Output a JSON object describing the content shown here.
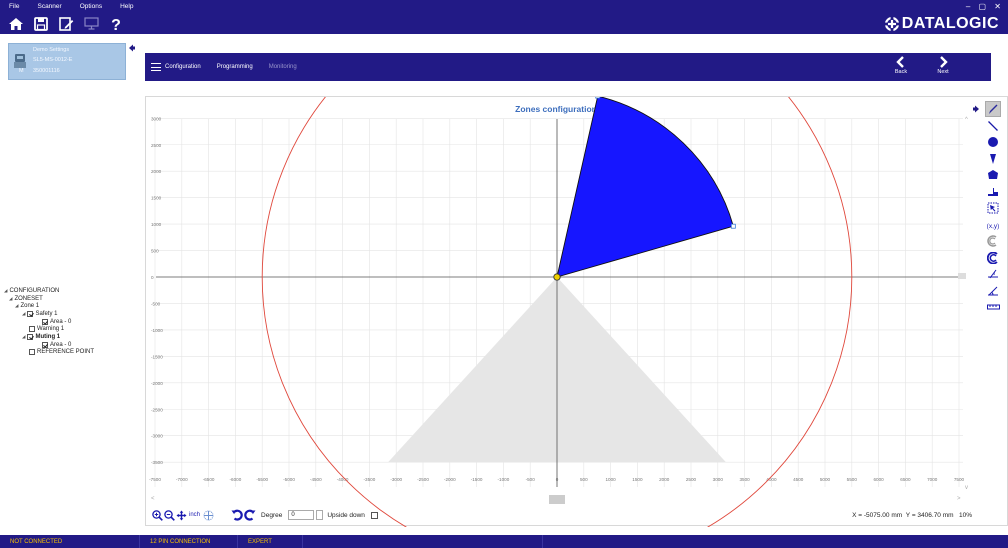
{
  "menu": {
    "items": [
      "File",
      "Scanner",
      "Options",
      "Help"
    ],
    "window_controls": "– ▢ ✕"
  },
  "brand": {
    "name": "DATALOGIC"
  },
  "device": {
    "title": "Demo Settings",
    "model": "SL5-MS-0012-E",
    "serial_prefix": "M",
    "serial": "350001116"
  },
  "nav": {
    "tabs": [
      "Configuration",
      "Programming",
      "Monitoring"
    ],
    "back_label": "Back",
    "next_label": "Next"
  },
  "tree": {
    "configuration": "CONFIGURATION",
    "zoneset": "ZONESET",
    "zone1": "Zone 1",
    "safety1": "Safety 1",
    "safety_area": "Area - 0",
    "warning1": "Warning 1",
    "muting1": "Muting 1",
    "muting_area": "Area - 0",
    "reference_point": "REFERENCE POINT"
  },
  "chart_data": {
    "type": "polar-zone-editor",
    "title": "Zones configuration",
    "xlim": [
      -7500,
      7500
    ],
    "ylim": [
      -3500,
      3500
    ],
    "xticks": [
      -7500,
      -7000,
      -6500,
      -6000,
      -5500,
      -5000,
      -4500,
      -4000,
      -3500,
      -3000,
      -2500,
      -2000,
      -1500,
      -1000,
      -500,
      0,
      500,
      1000,
      1500,
      2000,
      2500,
      3000,
      3500,
      4000,
      4500,
      5000,
      5500,
      6000,
      6500,
      7000,
      7500
    ],
    "yticks": [
      3500,
      3000,
      2500,
      2000,
      1500,
      1000,
      500,
      0,
      -500,
      -1000,
      -1500,
      -2000,
      -2500,
      -3000,
      -3500
    ],
    "grid": true,
    "range_circle_radius": 5500,
    "safety_zone": {
      "color": "#1616ff",
      "vertices": [
        [
          0,
          0
        ],
        [
          760,
          3420
        ],
        [
          3290,
          960
        ]
      ]
    },
    "blind_area": {
      "apex": [
        0,
        0
      ],
      "left": [
        -3150,
        -3500
      ],
      "right": [
        3150,
        -3500
      ]
    }
  },
  "controls": {
    "unit_label": "inch",
    "degree_label": "Degree",
    "degree_value": "0",
    "upside_down_label": "Upside down",
    "cursor_x": "X = -5075.00 mm",
    "cursor_y": "Y = 3406.70 mm",
    "zoom": "10%"
  },
  "status": {
    "connection": "NOT CONNECTED",
    "pin": "12 PIN CONNECTION",
    "mode": "EXPERT"
  },
  "colors": {
    "brand_bar": "#221a86",
    "status_text": "#f5c000",
    "zone_fill": "#1616ff",
    "range_circle": "#e0483c"
  }
}
